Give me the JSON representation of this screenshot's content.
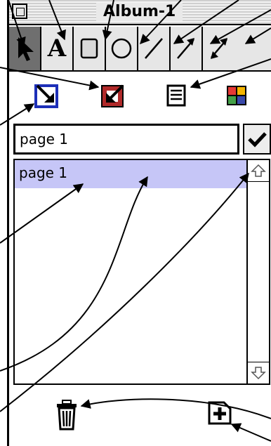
{
  "window": {
    "title": "Album-1"
  },
  "tools": [
    {
      "name": "arrow-tool",
      "selected": true
    },
    {
      "name": "text-tool",
      "glyph": "A"
    },
    {
      "name": "rectangle-tool"
    },
    {
      "name": "oval-tool"
    },
    {
      "name": "line-tool"
    },
    {
      "name": "arrow-line-tool"
    },
    {
      "name": "double-arrow-tool"
    }
  ],
  "actions": [
    {
      "icon": "import-icon",
      "color": "#1d2fb8"
    },
    {
      "icon": "export-icon",
      "color": "#b12a2a"
    },
    {
      "icon": "list-view-icon"
    },
    {
      "icon": "color-palette-icon"
    }
  ],
  "page_field": {
    "value": "page 1"
  },
  "page_list": {
    "items": [
      "page 1"
    ],
    "selected_color": "#c6c6f7"
  },
  "bottom": {
    "delete_icon": "trash-icon",
    "add_icon": "new-page-icon"
  }
}
